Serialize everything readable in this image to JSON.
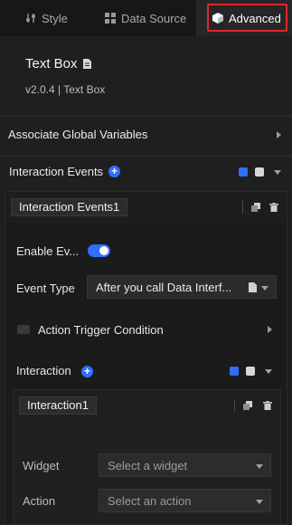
{
  "tabs": [
    {
      "label": "Style",
      "icon": "sliders-icon"
    },
    {
      "label": "Data Source",
      "icon": "grid-icon"
    },
    {
      "label": "Advanced",
      "icon": "cube-icon"
    }
  ],
  "widget": {
    "title": "Text Box",
    "subtitle": "v2.0.4 | Text Box"
  },
  "associate_global_variables": "Associate Global Variables",
  "interaction_events": {
    "label": "Interaction Events",
    "item_title": "Interaction Events1",
    "enable_label": "Enable Ev...",
    "event_type_label": "Event Type",
    "event_type_value": "After you call Data Interf...",
    "action_trigger_label": "Action Trigger Condition",
    "interaction_label": "Interaction",
    "interaction_item": {
      "title": "Interaction1",
      "widget_label": "Widget",
      "widget_placeholder": "Select a widget",
      "action_label": "Action",
      "action_placeholder": "Select an action"
    }
  },
  "colors": {
    "accent": "#2f6fff",
    "highlight_border": "#e0262f",
    "background": "#1f1f1f"
  }
}
